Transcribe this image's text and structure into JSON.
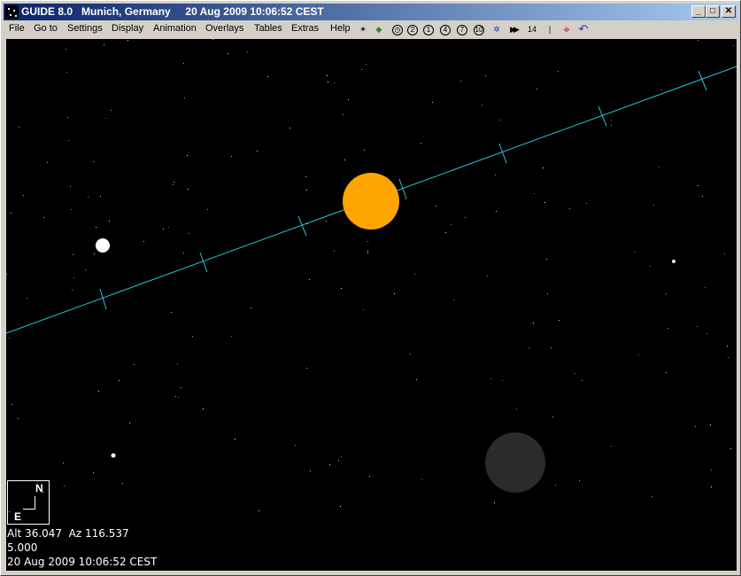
{
  "window": {
    "title_app": "GUIDE 8.0",
    "title_location": "Munich, Germany",
    "title_datetime": "20 Aug 2009 10:06:52 CEST",
    "min_label": "_",
    "max_label": "□",
    "close_label": "✕"
  },
  "menu": {
    "items": [
      "File",
      "Go to",
      "Settings",
      "Display",
      "Animation",
      "Overlays",
      "Tables",
      "Extras",
      "Help"
    ]
  },
  "toolbar": {
    "tools": [
      {
        "name": "star-tool-icon",
        "label": "✶"
      },
      {
        "name": "leaf-tool-icon",
        "label": "◆"
      },
      {
        "name": "clock-icon",
        "label": "◷"
      },
      {
        "name": "zoom-2-icon",
        "label": "2"
      },
      {
        "name": "zoom-1-icon",
        "label": "1"
      },
      {
        "name": "zoom-4-icon",
        "label": "4"
      },
      {
        "name": "zoom-7-icon",
        "label": "7"
      },
      {
        "name": "zoom-10-icon",
        "label": "10"
      },
      {
        "name": "network-icon",
        "label": "✲"
      },
      {
        "name": "fast-forward-icon",
        "label": "▶▶"
      },
      {
        "name": "step-14-icon",
        "label": "14"
      },
      {
        "name": "pause-bar-icon",
        "label": "|"
      },
      {
        "name": "target-icon",
        "label": "⌖"
      },
      {
        "name": "undo-icon",
        "label": "↶"
      }
    ]
  },
  "sky": {
    "background_color": "#000000",
    "ecliptic_color": "#22c8d8",
    "sun_color": "#ffa500",
    "moon_color": "#2b2b2b",
    "compass": {
      "north": "N",
      "east": "E"
    }
  },
  "status": {
    "alt_az": "Alt 36.047  Az 116.537",
    "field": "5.000",
    "datetime": "20 Aug 2009 10:06:52 CEST"
  }
}
